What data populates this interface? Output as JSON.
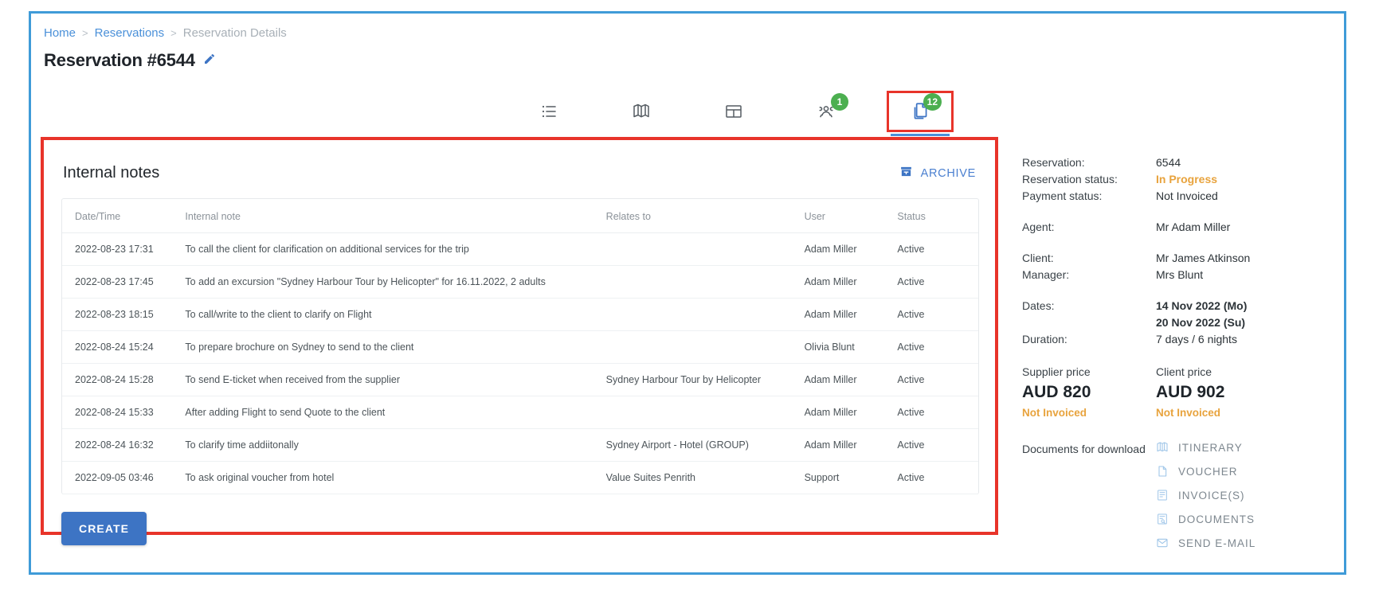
{
  "breadcrumb": {
    "home": "Home",
    "sep": ">",
    "reservations": "Reservations",
    "current": "Reservation Details"
  },
  "header": {
    "title": "Reservation #6544",
    "edit_icon": "pencil-icon"
  },
  "tabs": [
    {
      "name": "list",
      "icon": "list-icon",
      "badge": ""
    },
    {
      "name": "map",
      "icon": "map-icon",
      "badge": ""
    },
    {
      "name": "grid",
      "icon": "table-grid-icon",
      "badge": ""
    },
    {
      "name": "travellers",
      "icon": "travellers-icon",
      "badge": "1"
    },
    {
      "name": "documents",
      "icon": "documents-copy-icon",
      "badge": "12",
      "active": true
    }
  ],
  "notes": {
    "title": "Internal notes",
    "archive_label": "ARCHIVE",
    "archive_icon": "archive-box-icon",
    "create_label": "CREATE",
    "columns": [
      "Date/Time",
      "Internal note",
      "Relates to",
      "User",
      "Status"
    ],
    "rows": [
      {
        "datetime": "2022-08-23 17:31",
        "note": "To call the client for clarification on additional services for the trip",
        "relates_to": "",
        "user": "Adam Miller",
        "status": "Active"
      },
      {
        "datetime": "2022-08-23 17:45",
        "note": "To add an excursion \"Sydney Harbour Tour by Helicopter\" for 16.11.2022, 2 adults",
        "relates_to": "",
        "user": "Adam Miller",
        "status": "Active"
      },
      {
        "datetime": "2022-08-23 18:15",
        "note": "To call/write to the client to clarify on Flight",
        "relates_to": "",
        "user": "Adam Miller",
        "status": "Active"
      },
      {
        "datetime": "2022-08-24 15:24",
        "note": "To prepare brochure on Sydney to send to the client",
        "relates_to": "",
        "user": "Olivia Blunt",
        "status": "Active"
      },
      {
        "datetime": "2022-08-24 15:28",
        "note": "To send E-ticket when received from the supplier",
        "relates_to": "Sydney Harbour Tour by Helicopter",
        "user": "Adam Miller",
        "status": "Active"
      },
      {
        "datetime": "2022-08-24 15:33",
        "note": "After adding Flight to send Quote to the client",
        "relates_to": "",
        "user": "Adam Miller",
        "status": "Active"
      },
      {
        "datetime": "2022-08-24 16:32",
        "note": "To clarify time addiitonally",
        "relates_to": "Sydney Airport - Hotel (GROUP)",
        "user": "Adam Miller",
        "status": "Active"
      },
      {
        "datetime": "2022-09-05 03:46",
        "note": "To ask original voucher from hotel",
        "relates_to": "Value Suites Penrith",
        "user": "Support",
        "status": "Active"
      }
    ]
  },
  "summary": {
    "reservation_label": "Reservation:",
    "reservation_value": "6544",
    "reservation_status_label": "Reservation status:",
    "reservation_status_value": "In Progress",
    "payment_status_label": "Payment status:",
    "payment_status_value": "Not Invoiced",
    "agent_label": "Agent:",
    "agent_value": "Mr Adam Miller",
    "client_label": "Client:",
    "client_value": "Mr James Atkinson",
    "manager_label": "Manager:",
    "manager_value": "Mrs Blunt",
    "dates_label": "Dates:",
    "date_from": "14 Nov 2022 (Mo)",
    "date_to": "20 Nov 2022 (Su)",
    "duration_label": "Duration:",
    "duration_value": "7 days / 6 nights",
    "supplier_price_label": "Supplier price",
    "supplier_price_amount": "AUD 820",
    "supplier_price_status": "Not Invoiced",
    "client_price_label": "Client price",
    "client_price_amount": "AUD 902",
    "client_price_status": "Not Invoiced",
    "documents_label": "Documents for download",
    "documents": [
      {
        "label": "ITINERARY",
        "icon": "itinerary-book-icon"
      },
      {
        "label": "VOUCHER",
        "icon": "voucher-file-icon"
      },
      {
        "label": "INVOICE(S)",
        "icon": "invoice-lines-icon"
      },
      {
        "label": "DOCUMENTS",
        "icon": "documents-search-icon"
      },
      {
        "label": "SEND E-MAIL",
        "icon": "envelope-icon"
      }
    ]
  },
  "colors": {
    "outer_frame": "#3f9bd8",
    "highlight": "#e8342a",
    "link": "#4a90d9",
    "primary_button": "#3d74c4",
    "badge_green": "#4caf50",
    "warn_amber": "#e8a33d"
  }
}
